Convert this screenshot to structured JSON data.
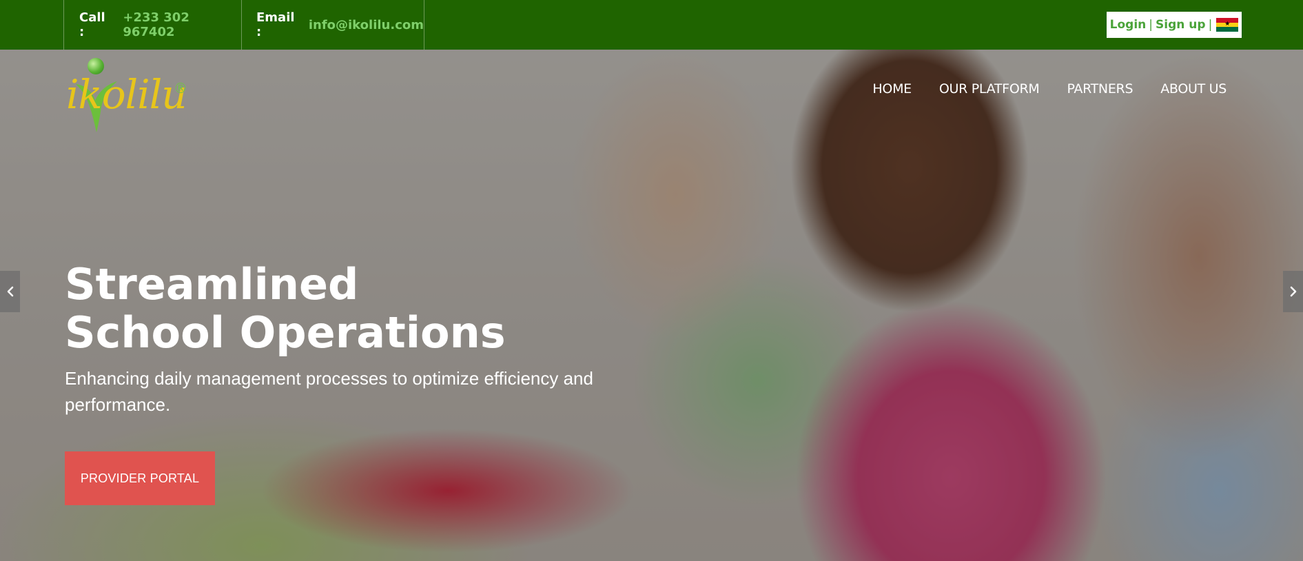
{
  "topbar": {
    "call_label": "Call :",
    "call_value": "+233 302 967402",
    "email_label": "Email :",
    "email_value": "info@ikolilu.com",
    "login_label": "Login",
    "signup_label": "Sign up",
    "separator": "|",
    "flag_icon": "ghana-flag-icon"
  },
  "logo": {
    "text": "ikolilu",
    "registered_mark": "®"
  },
  "nav": {
    "items": [
      {
        "label": "HOME"
      },
      {
        "label": "OUR PLATFORM"
      },
      {
        "label": "PARTNERS"
      },
      {
        "label": "ABOUT US"
      }
    ]
  },
  "hero": {
    "headline": "Streamlined School Operations",
    "subheadline": "Enhancing daily management processes to optimize efficiency and performance.",
    "cta_label": "PROVIDER PORTAL",
    "prev_icon": "chevron-left-icon",
    "next_icon": "chevron-right-icon"
  },
  "colors": {
    "topbar_bg": "#1f6400",
    "contact_value": "#7fcf6a",
    "auth_link": "#4aa339",
    "cta_bg": "#e0534f",
    "logo_yellow": "#e7c51b",
    "logo_green": "#59b334"
  }
}
